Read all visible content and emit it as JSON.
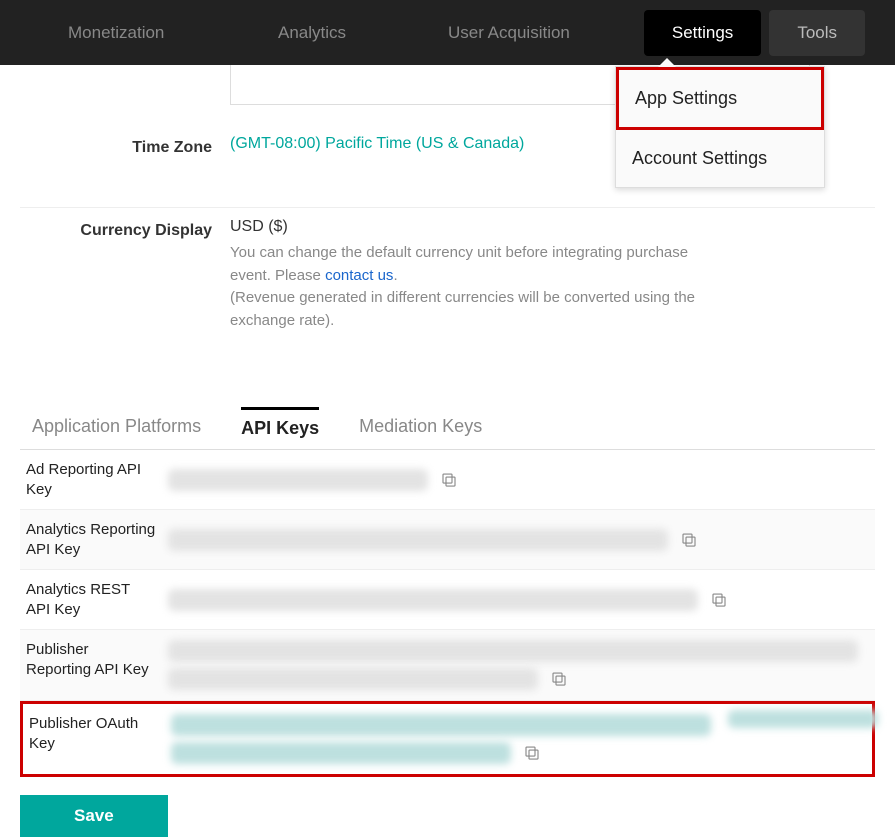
{
  "nav": {
    "monetization": "Monetization",
    "analytics": "Analytics",
    "user_acq": "User Acquisition",
    "settings": "Settings",
    "tools": "Tools"
  },
  "dropdown": {
    "app_settings": "App Settings",
    "account_settings": "Account Settings"
  },
  "form": {
    "timezone_label": "Time Zone",
    "timezone_value": "(GMT-08:00) Pacific Time (US & Canada)",
    "currency_label": "Currency Display",
    "currency_value": "USD ($)",
    "currency_desc1": "You can change the default currency unit before integrating purchase event. Please ",
    "currency_contact": "contact us",
    "currency_desc2": ".",
    "currency_desc3": "(Revenue generated in different currencies will be converted using the exchange rate)."
  },
  "tabs": {
    "platforms": "Application Platforms",
    "api_keys": "API Keys",
    "mediation": "Mediation Keys"
  },
  "keys": {
    "ad_reporting": "Ad Reporting API Key",
    "analytics_reporting": "Analytics Reporting API Key",
    "analytics_rest": "Analytics REST API Key",
    "publisher_reporting": "Publisher Reporting API Key",
    "publisher_oauth": "Publisher OAuth Key"
  },
  "buttons": {
    "save": "Save"
  }
}
